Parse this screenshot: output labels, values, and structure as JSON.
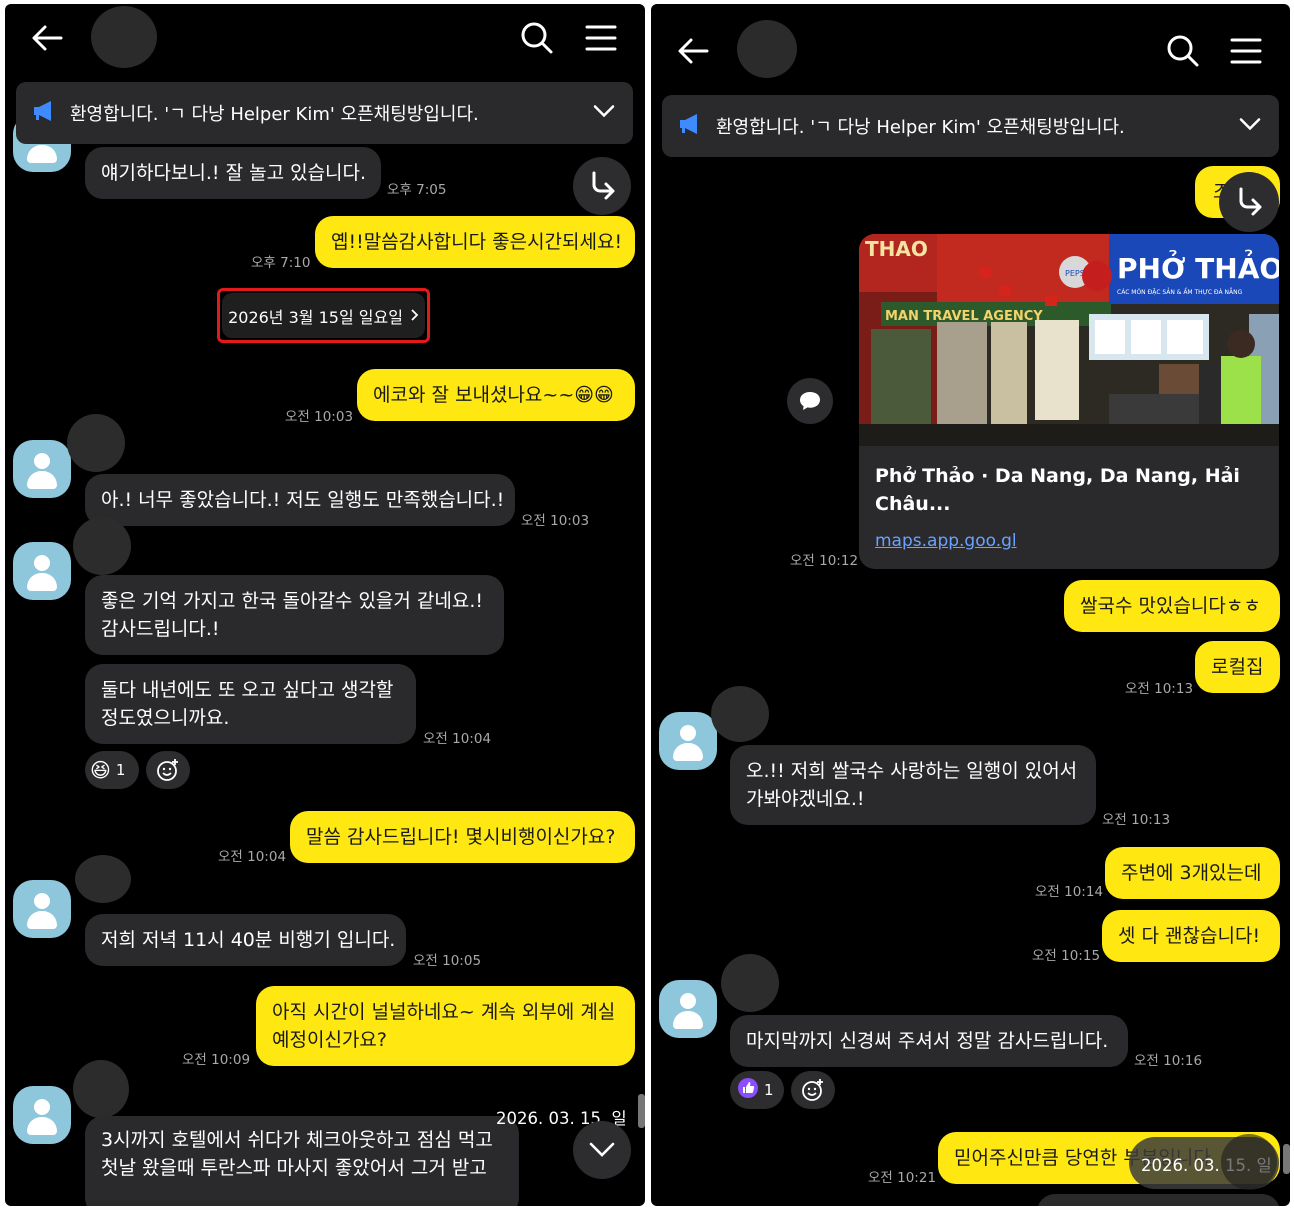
{
  "notice_text": "환영합니다. 'ㄱ 다낭 Helper Kim' 오픈채팅방입니다.",
  "colors": {
    "my_bubble": "#ffe812",
    "other_bubble": "#2a2a2c",
    "avatar": "#8ec6dc",
    "highlight_box": "#e31a1a",
    "link": "#6aa2ff"
  },
  "left": {
    "messages": [
      {
        "text": "얘기하다보니.! 잘 놀고 있습니다.",
        "time": "오후 7:05"
      },
      {
        "text": "옙!!말씀감사합니다 좋은시간되세요!",
        "time": "오후 7:10"
      },
      {
        "text": "에코와 잘 보내셨나요~~😁😁",
        "time": "오전 10:03"
      },
      {
        "text": "아.! 너무 좋았습니다.! 저도 일행도 만족했습니다.!",
        "time": "오전 10:03"
      },
      {
        "line1": "좋은 기억 가지고 한국 돌아갈수 있을거 같네요.!",
        "line2": "감사드립니다.!"
      },
      {
        "line1": "둘다 내년에도 또 오고 싶다고 생각할",
        "line2": "정도였으니까요.",
        "time": "오전 10:04"
      },
      {
        "text": "말씀 감사드립니다! 몇시비행이신가요?",
        "time": "오전 10:04"
      },
      {
        "text": "저희 저녁 11시 40분 비행기 입니다.",
        "time": "오전 10:05"
      },
      {
        "line1": "아직 시간이 널널하네요~ 계속 외부에 계실",
        "line2": "예정이신가요?",
        "time": "오전 10:09"
      },
      {
        "line1": "3시까지 호텔에서 쉬다가 체크아웃하고 점심 먹고",
        "line2": "첫날 왔을때 투란스파 마사지 좋았어서 그거 받고"
      }
    ],
    "date_divider": "2026년 3월 15일 일요일",
    "reaction_count": "1",
    "floating_date": "2026. 03. 15. 일"
  },
  "right": {
    "card": {
      "title_line1": "Phở Thảo · Da Nang, Da Nang, Hải",
      "title_line2": "Châu...",
      "url": "maps.app.goo.gl",
      "time": "오전 10:12",
      "sign_text": "PHỞ THẢO",
      "sign_sub": "CÁC MÓN ĐẶC SẢN & ẨM THỰC ĐÀ NẴNG",
      "agency_text": "MAN TRAVEL AGENCY",
      "pepsi_text": "PEPSI"
    },
    "partial_top_char": "조",
    "messages": [
      {
        "text": "쌀국수 맛있습니다ㅎㅎ"
      },
      {
        "text": "로컬집",
        "time": "오전 10:13"
      },
      {
        "line1": "오.!! 저희 쌀국수 사랑하는 일행이 있어서",
        "line2": "가봐야겠네요.!",
        "time": "오전 10:13"
      },
      {
        "text": "주변에 3개있는데",
        "time": "오전 10:14"
      },
      {
        "text": "셋 다 괜찮습니다!",
        "time": "오전 10:15"
      },
      {
        "text": "마지막까지 신경써 주셔서 정말 감사드립니다.",
        "time": "오전 10:16"
      },
      {
        "text": "믿어주신만큼 당연한 부분입니다",
        "time": "오전 10:21"
      }
    ],
    "reaction_count": "1",
    "floating_date": "2026. 03. 15. 일"
  }
}
